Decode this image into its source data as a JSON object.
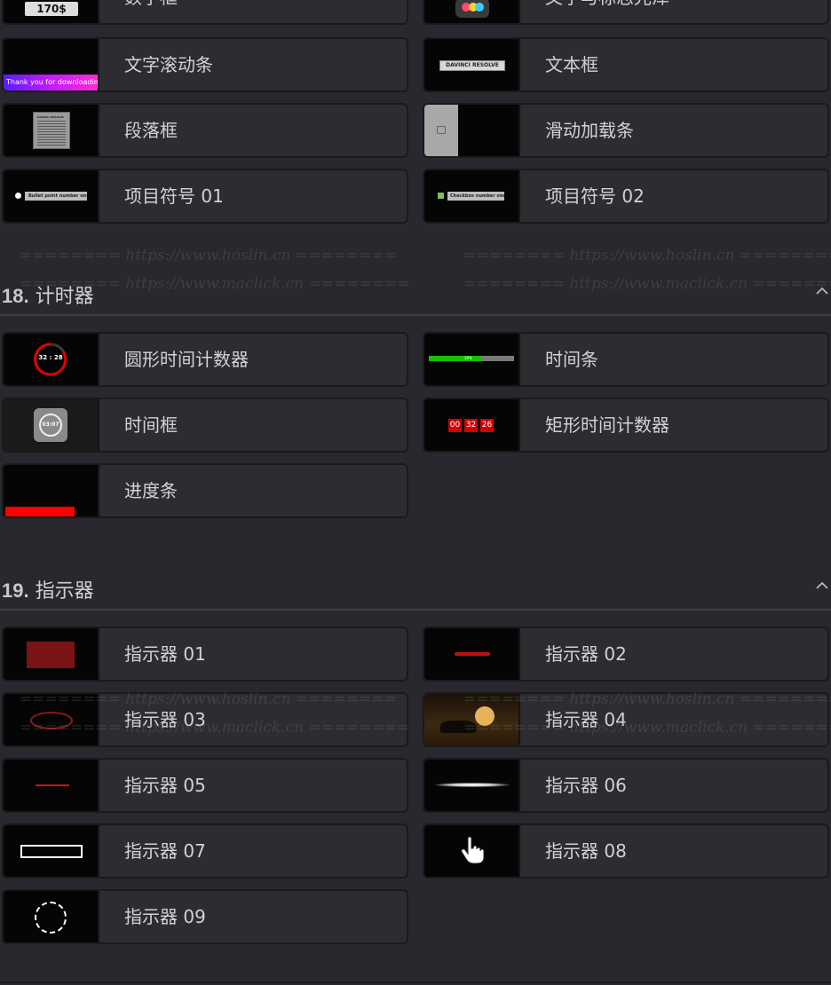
{
  "top_partial": {
    "left_label": "数字框",
    "right_label": "文字与标志光泽",
    "left_thumb_text": "170$"
  },
  "group17_items": [
    {
      "label": "文字滚动条",
      "thumb_text": "Thank you for downloading"
    },
    {
      "label": "文本框",
      "thumb_text": "DAVINCI RESOLVE"
    },
    {
      "label": "段落框",
      "thumb_text": "DAVINCI RESOLVE"
    },
    {
      "label": "滑动加载条"
    },
    {
      "label": "项目符号 01",
      "thumb_text": "Bullet point number one"
    },
    {
      "label": "项目符号 02",
      "thumb_text": "Checkbox number one"
    }
  ],
  "section18": {
    "number": "18.",
    "title": "计时器",
    "items": [
      {
        "label": "圆形时间计数器",
        "thumb_text": "32 : 28"
      },
      {
        "label": "时间条",
        "thumb_text": "30%"
      },
      {
        "label": "时间框",
        "thumb_text": "03:07"
      },
      {
        "label": "矩形时间计数器",
        "digits": [
          "00",
          "32",
          "26"
        ]
      },
      {
        "label": "进度条"
      }
    ]
  },
  "section19": {
    "number": "19.",
    "title": "指示器",
    "items": [
      {
        "label": "指示器 01"
      },
      {
        "label": "指示器 02"
      },
      {
        "label": "指示器 03"
      },
      {
        "label": "指示器 04"
      },
      {
        "label": "指示器 05"
      },
      {
        "label": "指示器 06"
      },
      {
        "label": "指示器 07"
      },
      {
        "label": "指示器 08"
      },
      {
        "label": "指示器 09"
      }
    ]
  },
  "watermarks": {
    "line1": "======== https://www.hoslin.cn ========",
    "line2": "======== https://www.maclick.cn ========"
  },
  "colors": {
    "background": "#28282e",
    "card": "#2c2c31",
    "accent_red": "#e00000",
    "accent_green": "#18c000",
    "gradient_purple": "#7a1cff",
    "gradient_pink": "#ff2bd0"
  }
}
